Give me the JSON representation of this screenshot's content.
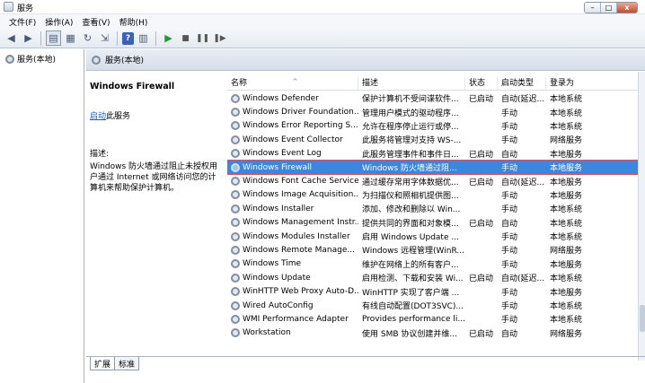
{
  "window": {
    "title": "服务"
  },
  "menu": [
    "文件(F)",
    "操作(A)",
    "查看(V)",
    "帮助(H)"
  ],
  "tree": {
    "root": "服务(本地)"
  },
  "content_header": "服务(本地)",
  "detail": {
    "title": "Windows Firewall",
    "action_link": "启动",
    "action_suffix": "此服务",
    "desc_label": "描述:",
    "desc_text": "Windows 防火墙通过阻止未授权用户通过 Internet 或网络访问您的计算机来帮助保护计算机。"
  },
  "columns": [
    "名称",
    "描述",
    "状态",
    "启动类型",
    "登录为"
  ],
  "services": [
    {
      "name": "Windows Defender",
      "desc": "保护计算机不受间谍软件...",
      "status": "已启动",
      "start": "自动(延迟...",
      "logon": "本地系统"
    },
    {
      "name": "Windows Driver Foundation...",
      "desc": "管理用户模式的驱动程序...",
      "status": "",
      "start": "手动",
      "logon": "本地系统"
    },
    {
      "name": "Windows Error Reporting S...",
      "desc": "允许在程序停止运行或停...",
      "status": "",
      "start": "手动",
      "logon": "本地系统"
    },
    {
      "name": "Windows Event Collector",
      "desc": "此服务将管理对支持 WS-...",
      "status": "",
      "start": "手动",
      "logon": "网络服务"
    },
    {
      "name": "Windows Event Log",
      "desc": "此服务管理事件和事件日...",
      "status": "已启动",
      "start": "自动",
      "logon": "本地服务"
    },
    {
      "name": "Windows Firewall",
      "desc": "Windows 防火墙通过阻...",
      "status": "",
      "start": "手动",
      "logon": "本地服务"
    },
    {
      "name": "Windows Font Cache Service",
      "desc": "通过缓存常用字体数据优...",
      "status": "已启动",
      "start": "自动(延迟...",
      "logon": "本地服务"
    },
    {
      "name": "Windows Image Acquisition...",
      "desc": "为扫描仪和照相机提供图...",
      "status": "",
      "start": "手动",
      "logon": "本地服务"
    },
    {
      "name": "Windows Installer",
      "desc": "添加、修改和删除以 Win...",
      "status": "",
      "start": "手动",
      "logon": "本地系统"
    },
    {
      "name": "Windows Management Instr...",
      "desc": "提供共同的界面和对象模...",
      "status": "已启动",
      "start": "自动",
      "logon": "本地系统"
    },
    {
      "name": "Windows Modules Installer",
      "desc": "启用 Windows Update ...",
      "status": "",
      "start": "手动",
      "logon": "本地系统"
    },
    {
      "name": "Windows Remote Manage...",
      "desc": "Windows 远程管理(WinR...",
      "status": "",
      "start": "手动",
      "logon": "网络服务"
    },
    {
      "name": "Windows Time",
      "desc": "维护在网络上的所有客户...",
      "status": "",
      "start": "手动",
      "logon": "本地服务"
    },
    {
      "name": "Windows Update",
      "desc": "启用检测、下载和安装 Wi...",
      "status": "已启动",
      "start": "自动(延迟...",
      "logon": "本地系统"
    },
    {
      "name": "WinHTTP Web Proxy Auto-D...",
      "desc": "WinHTTP 实现了客户端 ...",
      "status": "",
      "start": "手动",
      "logon": "本地服务"
    },
    {
      "name": "Wired AutoConfig",
      "desc": "有线自动配置(DOT3SVC)...",
      "status": "",
      "start": "手动",
      "logon": "本地系统"
    },
    {
      "name": "WMI Performance Adapter",
      "desc": "Provides performance li...",
      "status": "",
      "start": "手动",
      "logon": "本地系统"
    },
    {
      "name": "Workstation",
      "desc": "使用 SMB 协议创建并维...",
      "status": "已启动",
      "start": "自动",
      "logon": "网络服务"
    }
  ],
  "selected_index": 5,
  "tabs": [
    "扩展",
    "标准"
  ]
}
